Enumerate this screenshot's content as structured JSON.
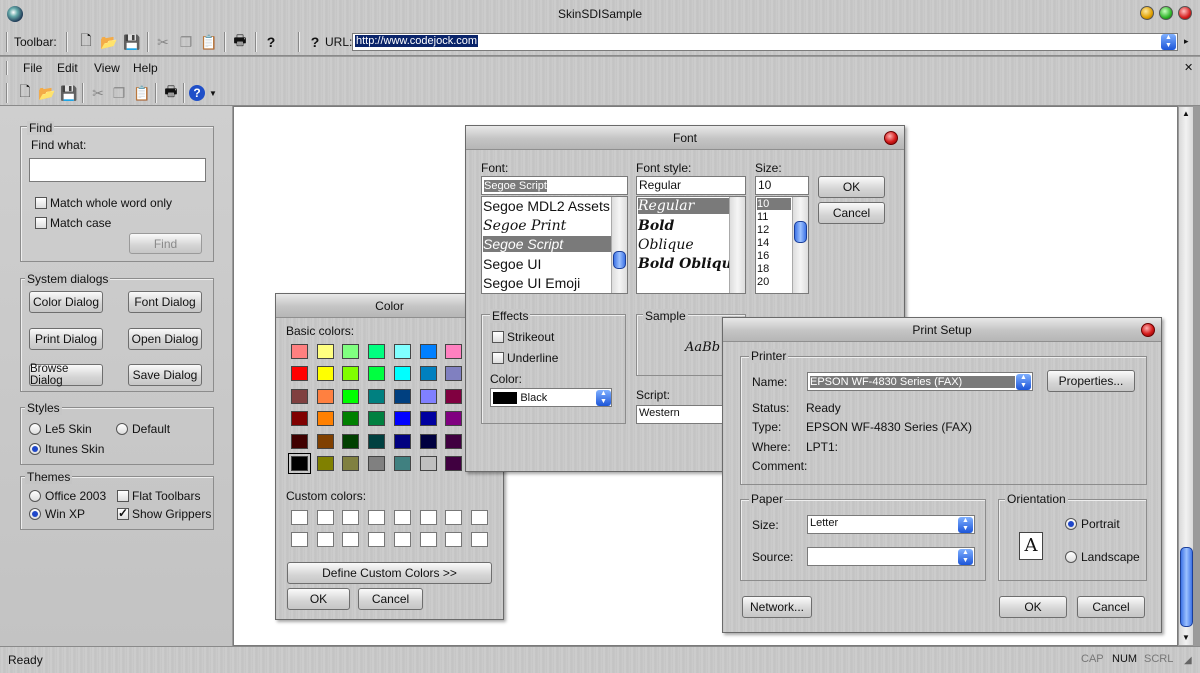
{
  "window": {
    "title": "SkinSDISample"
  },
  "toolbar": {
    "label": "Toolbar:",
    "url_label": "URL:",
    "url_value": "http://www.codejock.com"
  },
  "menu": {
    "items": [
      "File",
      "Edit",
      "View",
      "Help"
    ]
  },
  "left_panel": {
    "find": {
      "title": "Find",
      "find_what_label": "Find what:",
      "find_what_value": "",
      "match_whole_word": "Match whole word only",
      "match_case": "Match case",
      "find_button": "Find"
    },
    "system_dialogs": {
      "title": "System dialogs",
      "buttons": [
        "Color Dialog",
        "Font Dialog",
        "Print Dialog",
        "Open Dialog",
        "Browse Dialog",
        "Save Dialog"
      ]
    },
    "styles": {
      "title": "Styles",
      "options": [
        "Le5 Skin",
        "Default",
        "Itunes Skin"
      ],
      "selected": "Itunes Skin"
    },
    "themes": {
      "title": "Themes",
      "office2003": "Office 2003",
      "winxp": "Win XP",
      "flat_toolbars": "Flat Toolbars",
      "show_grippers": "Show Grippers",
      "selected_theme": "Win XP",
      "show_grippers_checked": true,
      "flat_toolbars_checked": false
    }
  },
  "color_dialog": {
    "title": "Color",
    "basic_colors_label": "Basic colors:",
    "custom_colors_label": "Custom colors:",
    "basic_colors": [
      "#ff8080",
      "#ffff80",
      "#80ff80",
      "#00ff80",
      "#80ffff",
      "#0080ff",
      "#ff80c0",
      "#ff80ff",
      "#ff0000",
      "#ffff00",
      "#80ff00",
      "#00ff40",
      "#00ffff",
      "#0080c0",
      "#8080c0",
      "#ff00ff",
      "#804040",
      "#ff8040",
      "#00ff00",
      "#008080",
      "#004080",
      "#8080ff",
      "#800040",
      "#ff0080",
      "#800000",
      "#ff8000",
      "#008000",
      "#008040",
      "#0000ff",
      "#0000a0",
      "#800080",
      "#8000ff",
      "#400000",
      "#804000",
      "#004000",
      "#004040",
      "#000080",
      "#000040",
      "#400040",
      "#400080",
      "#000000",
      "#808000",
      "#808040",
      "#808080",
      "#408080",
      "#c0c0c0",
      "#400040",
      "#ffffff"
    ],
    "define_button": "Define Custom Colors >>",
    "ok": "OK",
    "cancel": "Cancel"
  },
  "font_dialog": {
    "title": "Font",
    "font_label": "Font:",
    "font_value": "Segoe Script",
    "fonts": [
      "Segoe MDL2 Assets",
      "Segoe Print",
      "Segoe Script",
      "Segoe UI",
      "Segoe UI Emoji"
    ],
    "style_label": "Font style:",
    "style_value": "Regular",
    "styles": [
      "Regular",
      "Bold",
      "Oblique",
      "Bold Oblique"
    ],
    "size_label": "Size:",
    "size_value": "10",
    "sizes": [
      "10",
      "11",
      "12",
      "14",
      "16",
      "18",
      "20"
    ],
    "ok": "OK",
    "cancel": "Cancel",
    "effects_title": "Effects",
    "strikeout": "Strikeout",
    "underline": "Underline",
    "color_label": "Color:",
    "color_value": "Black",
    "sample_title": "Sample",
    "sample_text": "AaBb",
    "script_label": "Script:",
    "script_value": "Western"
  },
  "print_dialog": {
    "title": "Print Setup",
    "printer_title": "Printer",
    "name_label": "Name:",
    "name_value": "EPSON WF-4830 Series (FAX)",
    "properties": "Properties...",
    "status_label": "Status:",
    "status_value": "Ready",
    "type_label": "Type:",
    "type_value": "EPSON WF-4830 Series (FAX)",
    "where_label": "Where:",
    "where_value": "LPT1:",
    "comment_label": "Comment:",
    "comment_value": "",
    "paper_title": "Paper",
    "size_label": "Size:",
    "size_value": "Letter",
    "source_label": "Source:",
    "source_value": "",
    "orientation_title": "Orientation",
    "portrait": "Portrait",
    "landscape": "Landscape",
    "orientation_glyph": "A",
    "network": "Network...",
    "ok": "OK",
    "cancel": "Cancel"
  },
  "status": {
    "text": "Ready",
    "cap": "CAP",
    "num": "NUM",
    "scrl": "SCRL"
  }
}
